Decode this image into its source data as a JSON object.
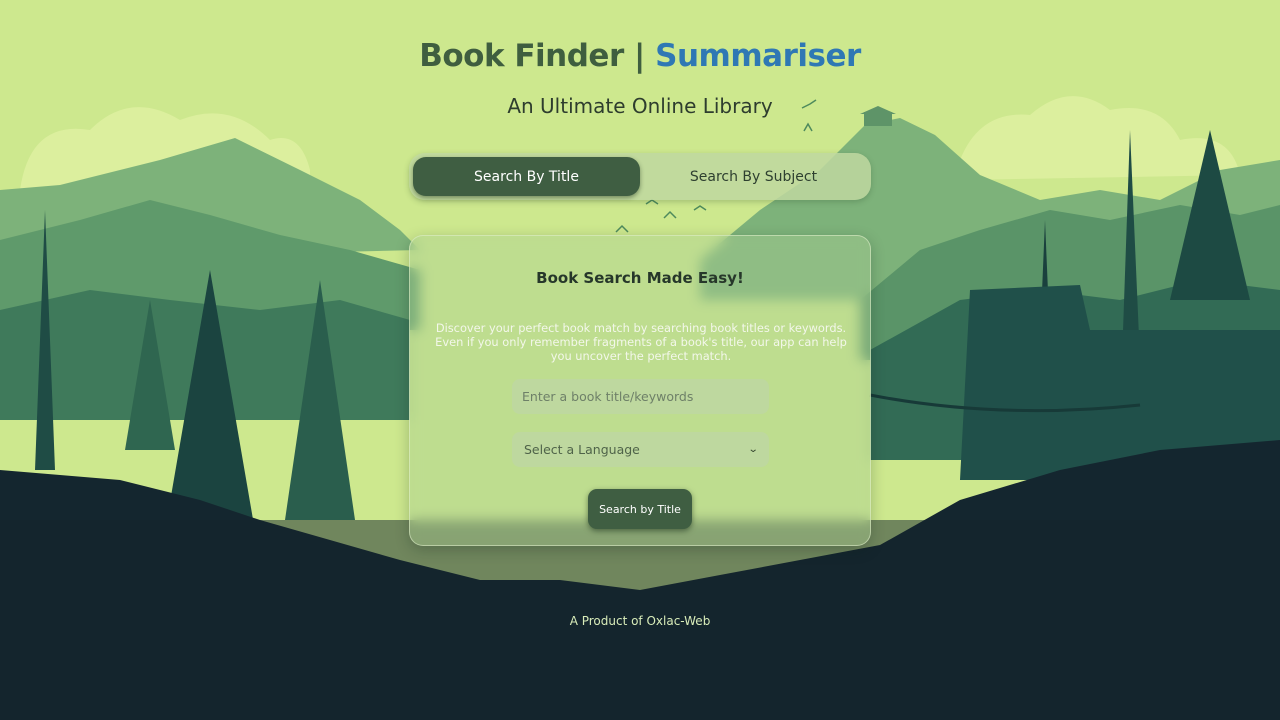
{
  "header": {
    "title_main": "Book Finder | ",
    "title_accent": "Summariser",
    "subtitle": "An Ultimate Online Library"
  },
  "tabs": [
    {
      "label": "Search By Title",
      "active": true
    },
    {
      "label": "Search By Subject",
      "active": false
    }
  ],
  "card": {
    "heading": "Book Search Made Easy!",
    "description": "Discover your perfect book match by searching book titles or keywords. Even if you only remember fragments of a book's title, our app can help you uncover the perfect match.",
    "search_placeholder": "Enter a book title/keywords",
    "language_select": "Select a Language",
    "button_label": "Search by Title"
  },
  "footer": {
    "text": "A Product of Oxlac-Web"
  },
  "colors": {
    "accent": "#2f78b4",
    "primary_green": "#3f5e42",
    "sky": "#cde88e"
  },
  "icons": {
    "select_chevron": "chevron-down-icon"
  }
}
